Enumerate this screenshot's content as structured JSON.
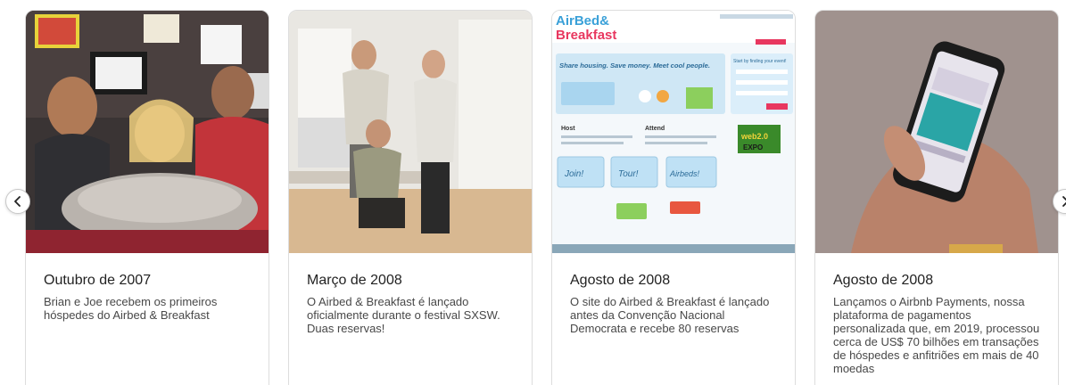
{
  "cards": [
    {
      "title": "Outubro de 2007",
      "description": "Brian e Joe recebem os primeiros hóspedes do Airbed & Breakfast"
    },
    {
      "title": "Março de 2008",
      "description": "O Airbed & Breakfast é lançado oficialmente durante o festival SXSW. Duas reservas!"
    },
    {
      "title": "Agosto de 2008",
      "description": "O site do Airbed & Breakfast é lançado antes da Convenção Nacional Democrata e recebe 80 reservas",
      "screenshot": {
        "logo_line1": "AirBed&",
        "logo_line2": "Breakfast",
        "headline": "Share housing. Save money. Meet cool people.",
        "host_label": "Host",
        "attend_label": "Attend",
        "join_label": "Join!",
        "tour_label": "Tour!",
        "airbeds_label": "Airbeds!",
        "finding_label": "Start by finding your event!",
        "event_line1": "web2.0",
        "event_line2": "EXPO"
      }
    },
    {
      "title": "Agosto de 2008",
      "description": "Lançamos o Airbnb Payments, nossa plataforma de pagamentos personalizada que, em 2019, processou cerca de US$ 70 bilhões em transações de hóspedes e anfitriões em mais de 40 moedas"
    }
  ],
  "nav": {
    "prev_icon": "chevron-left-icon",
    "next_icon": "chevron-right-icon"
  },
  "colors": {
    "title": "#222222",
    "text": "#484848",
    "border": "#dddddd",
    "brand_pink": "#e8375f",
    "brand_blue": "#3aa0d8"
  }
}
